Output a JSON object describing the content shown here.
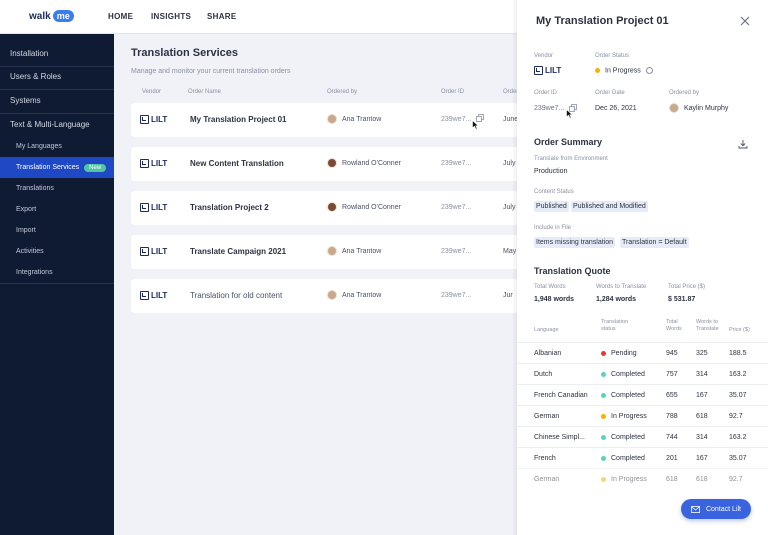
{
  "app": {
    "logo_text": "walk",
    "logo_badge": "me"
  },
  "topnav": [
    "HOME",
    "INSIGHTS",
    "SHARE"
  ],
  "sidebar": {
    "items": [
      {
        "label": "Installation"
      },
      {
        "label": "Users & Roles"
      },
      {
        "label": "Systems"
      },
      {
        "label": "Text & Multi-Language"
      }
    ],
    "subitems": [
      {
        "label": "My Languages"
      },
      {
        "label": "Translation Services",
        "badge": "New",
        "active": true
      },
      {
        "label": "Translations"
      },
      {
        "label": "Export"
      },
      {
        "label": "Import"
      },
      {
        "label": "Activities"
      },
      {
        "label": "Integrations"
      }
    ]
  },
  "main": {
    "title": "Translation Services",
    "subtitle": "Manage and monitor your current translation orders",
    "columns": [
      "Vendor",
      "Order Name",
      "Ordered by",
      "Order ID",
      "Order"
    ],
    "rows": [
      {
        "vendor": "LILT",
        "name": "My Translation Project 01",
        "ordered_by": "Ana Trantow",
        "avatar": "light",
        "order_id": "239we7...",
        "date": "June",
        "has_copy": true
      },
      {
        "vendor": "LILT",
        "name": "New Content Translation",
        "ordered_by": "Rowland O'Conner",
        "avatar": "dark",
        "order_id": "239we7...",
        "date": "July"
      },
      {
        "vendor": "LILT",
        "name": "Translation Project 2",
        "ordered_by": "Rowland O'Conner",
        "avatar": "dark",
        "order_id": "239we7...",
        "date": "July"
      },
      {
        "vendor": "LILT",
        "name": "Translate Campaign 2021",
        "ordered_by": "Ana Trantow",
        "avatar": "light",
        "order_id": "239we7...",
        "date": "May"
      },
      {
        "vendor": "LILT",
        "name": "Translation for old content",
        "ordered_by": "Ana Trantow",
        "avatar": "light",
        "order_id": "239we7...",
        "date": "Jur",
        "muted": true
      }
    ]
  },
  "panel": {
    "title": "My Translation Project 01",
    "vendor_label": "Vendor",
    "vendor_value": "LILT",
    "status_label": "Order Status",
    "status_value": "In Progress",
    "order_id_label": "Order ID",
    "order_id_value": "239we7...",
    "order_date_label": "Order Date",
    "order_date_value": "Dec 26, 2021",
    "ordered_by_label": "Ordered by",
    "ordered_by_value": "Kaylin Murphy",
    "summary_title": "Order Summary",
    "translate_from_label": "Translate from Environment",
    "translate_from_value": "Production",
    "content_status_label": "Content Status",
    "content_status_chips": [
      "Published",
      "Published and Modified"
    ],
    "include_label": "Include in File",
    "include_chips": [
      "Items missing translation",
      "Translation = Default"
    ],
    "quote_title": "Translation Quote",
    "total_words_label": "Total Words",
    "total_words_value": "1,948 words",
    "words_to_translate_label": "Words to Translate",
    "words_to_translate_value": "1,284 words",
    "total_price_label": "Total Price ($)",
    "total_price_value": "$ 531.87",
    "table_headers": {
      "language": "Language",
      "status": "Translation status",
      "total": "Total Words",
      "to_translate": "Words to Translate",
      "price": "Price ($)"
    },
    "table_rows": [
      {
        "language": "Albanian",
        "status": "Pending",
        "color": "#e53935",
        "total": "945",
        "to_translate": "325",
        "price": "188.5"
      },
      {
        "language": "Dutch",
        "status": "Completed",
        "color": "#5ad1c2",
        "total": "757",
        "to_translate": "314",
        "price": "163.2"
      },
      {
        "language": "French Canadian",
        "status": "Completed",
        "color": "#5ad1c2",
        "total": "655",
        "to_translate": "167",
        "price": "35.07"
      },
      {
        "language": "German",
        "status": "In Progress",
        "color": "#f3b300",
        "total": "788",
        "to_translate": "618",
        "price": "92.7"
      },
      {
        "language": "Chinese Simpl...",
        "status": "Completed",
        "color": "#5ad1c2",
        "total": "744",
        "to_translate": "314",
        "price": "163.2"
      },
      {
        "language": "French",
        "status": "Completed",
        "color": "#5ad1c2",
        "total": "201",
        "to_translate": "167",
        "price": "35.07"
      },
      {
        "language": "German",
        "status": "In Progress",
        "color": "#f3b300",
        "total": "618",
        "to_translate": "618",
        "price": "92.7"
      }
    ],
    "contact_button": "Contact Lilt"
  },
  "colors": {
    "sidebar_bg": "#0f1a33",
    "active_item": "#1e48c4",
    "accent": "#3a63e0",
    "new_badge": "#4fc6a3",
    "in_progress": "#f3b300"
  }
}
